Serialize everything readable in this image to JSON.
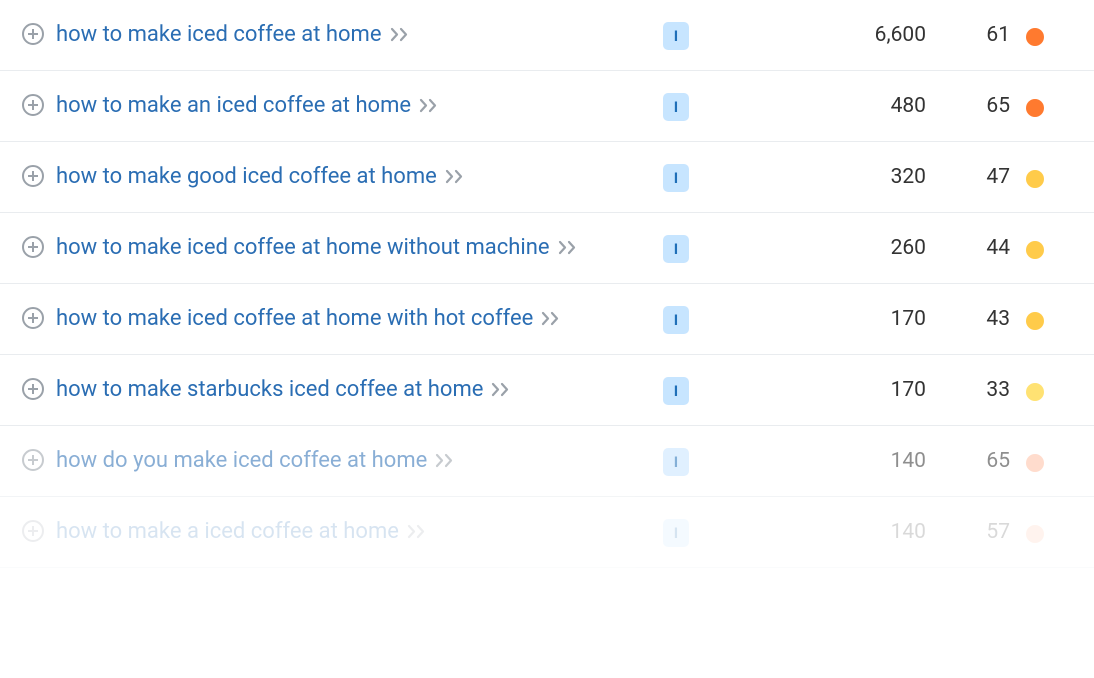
{
  "intent_label": "I",
  "colors": {
    "orange": "#ff7a2f",
    "yellow": "#ffcb4a",
    "pale_yellow": "#ffe273",
    "pale_orange": "#ffc0a6"
  },
  "rows": [
    {
      "keyword": "how to make iced coffee at home",
      "volume": "6,600",
      "kd": "61",
      "dot": "orange",
      "fade": 0
    },
    {
      "keyword": "how to make an iced coffee at home",
      "volume": "480",
      "kd": "65",
      "dot": "orange",
      "fade": 0
    },
    {
      "keyword": "how to make good iced coffee at home",
      "volume": "320",
      "kd": "47",
      "dot": "yellow",
      "fade": 0
    },
    {
      "keyword": "how to make iced coffee at home without machine",
      "volume": "260",
      "kd": "44",
      "dot": "yellow",
      "fade": 0
    },
    {
      "keyword": "how to make iced coffee at home with hot coffee",
      "volume": "170",
      "kd": "43",
      "dot": "yellow",
      "fade": 0
    },
    {
      "keyword": "how to make starbucks iced coffee at home",
      "volume": "170",
      "kd": "33",
      "dot": "pale_yellow",
      "fade": 0
    },
    {
      "keyword": "how do you make iced coffee at home",
      "volume": "140",
      "kd": "65",
      "dot": "pale_orange",
      "fade": 1
    },
    {
      "keyword": "how to make a iced coffee at home",
      "volume": "140",
      "kd": "57",
      "dot": "pale_orange",
      "fade": 2
    }
  ]
}
